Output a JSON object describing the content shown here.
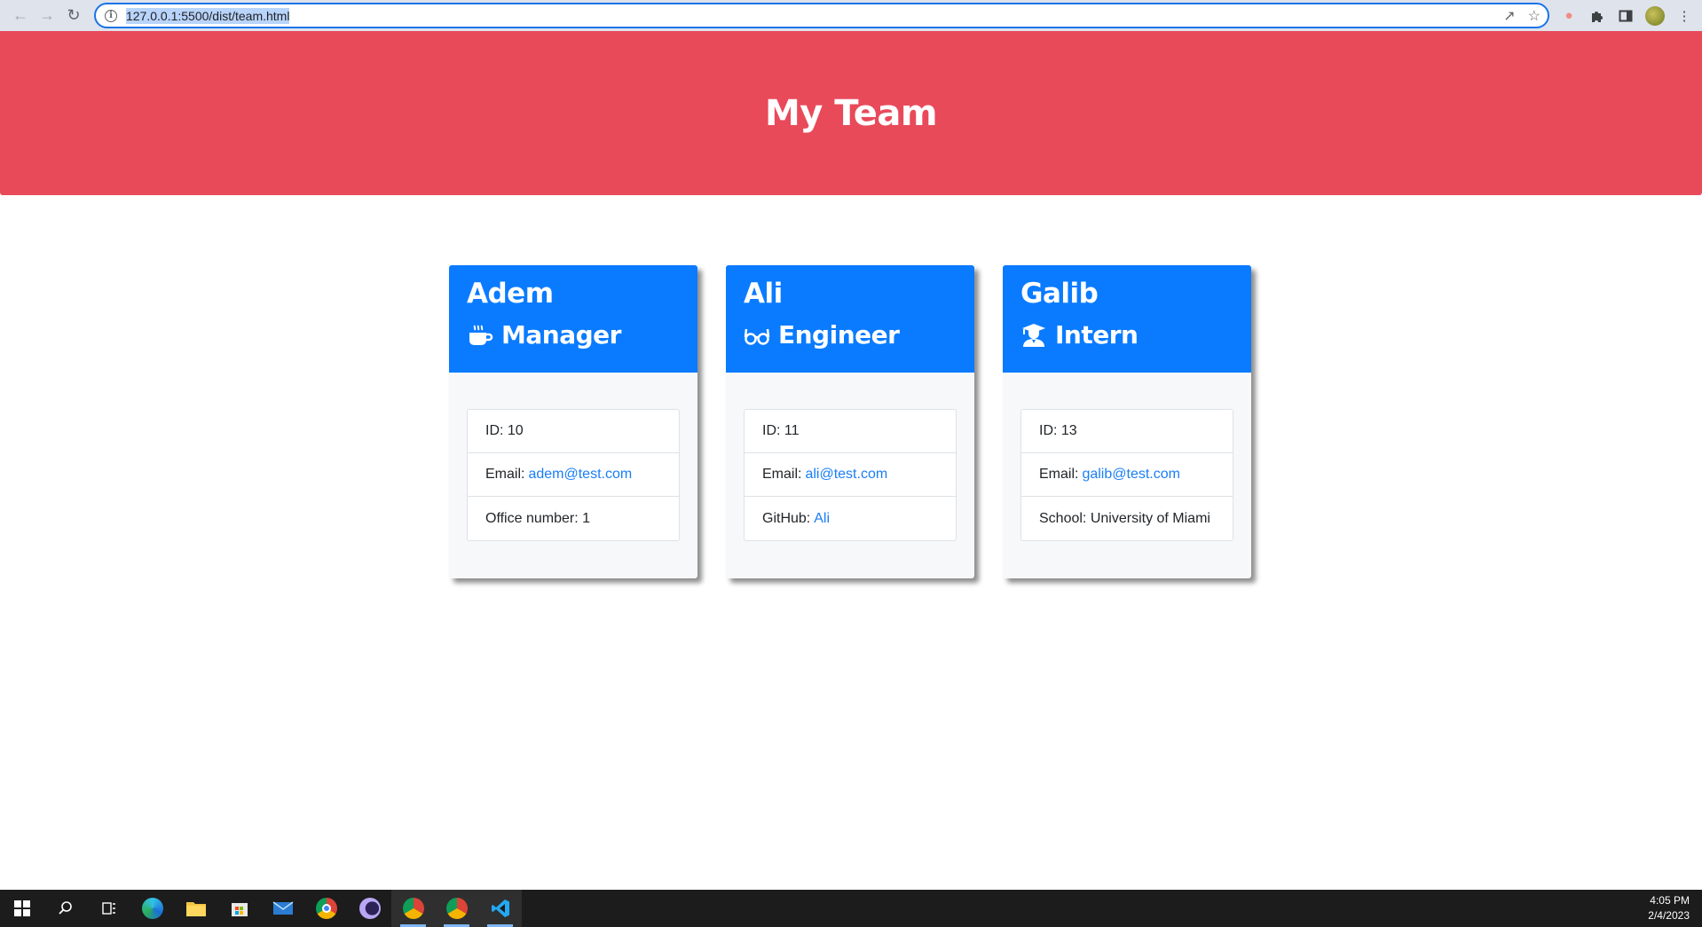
{
  "browser": {
    "url": "127.0.0.1:5500/dist/team.html"
  },
  "header": {
    "title": "My Team"
  },
  "team": [
    {
      "name": "Adem",
      "role": "Manager",
      "icon": "coffee-icon",
      "id_label": "ID:",
      "id": "10",
      "email_label": "Email:",
      "email": "adem@test.com",
      "extra_label": "Office number:",
      "extra": "1"
    },
    {
      "name": "Ali",
      "role": "Engineer",
      "icon": "glasses-icon",
      "id_label": "ID:",
      "id": "11",
      "email_label": "Email:",
      "email": "ali@test.com",
      "extra_label": "GitHub:",
      "extra": "Ali"
    },
    {
      "name": "Galib",
      "role": "Intern",
      "icon": "graduate-icon",
      "id_label": "ID:",
      "id": "13",
      "email_label": "Email:",
      "email": "galib@test.com",
      "extra_label": "School:",
      "extra": "University of Miami"
    }
  ],
  "taskbar": {
    "time": "4:05 PM",
    "date": "2/4/2023"
  },
  "colors": {
    "jumbotron": "#e84a5a",
    "card_header": "#0a7bff",
    "link": "#1a7ef5"
  }
}
